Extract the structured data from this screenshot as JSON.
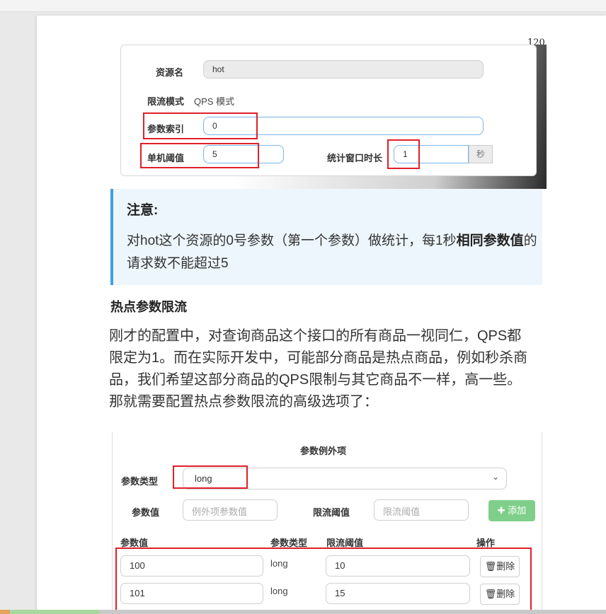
{
  "page": {
    "number": "120"
  },
  "screenshot1": {
    "resource_label": "资源名",
    "resource_value": "hot",
    "mode_label": "限流模式",
    "mode_value": "QPS 模式",
    "index_label": "参数索引",
    "index_value": "0",
    "threshold_label": "单机阈值",
    "threshold_value": "5",
    "window_label": "统计窗口时长",
    "window_value": "1",
    "window_unit": "秒"
  },
  "note": {
    "title": "注意:",
    "body_part1": "对hot这个资源的0号参数（第一个参数）做统计，每1秒",
    "body_bold": "相同参数值",
    "body_part2": "的请求数不能超过5"
  },
  "section": {
    "heading": "热点参数限流",
    "line1": "刚才的配置中，对查询商品这个接口的所有商品一视同仁，QPS都",
    "line2": "限定为1。而在实际开发中，可能部分商品是热点商品，例如秒杀商",
    "line3": "品，我们希望这部分商品的QPS限制与其它商品不一样，高一些。",
    "line4": "那就需要配置热点参数限流的高级选项了："
  },
  "screenshot2": {
    "title": "参数例外项",
    "type_label": "参数类型",
    "type_value": "long",
    "param_label": "参数值",
    "param_placeholder": "例外项参数值",
    "limit_label": "限流阈值",
    "limit_placeholder": "限流阈值",
    "add_button": "添加",
    "table": {
      "headers": [
        "参数值",
        "参数类型",
        "限流阈值",
        "操作"
      ],
      "rows": [
        {
          "value": "100",
          "type": "long",
          "limit": "10",
          "action": "删除"
        },
        {
          "value": "101",
          "type": "long",
          "limit": "15",
          "action": "删除"
        }
      ]
    }
  },
  "colors": {
    "note_accent": "#3ea0e4",
    "highlight_box": "#e0202a",
    "add_button": "#7fcf8a",
    "input_border": "#7ab6e6"
  }
}
